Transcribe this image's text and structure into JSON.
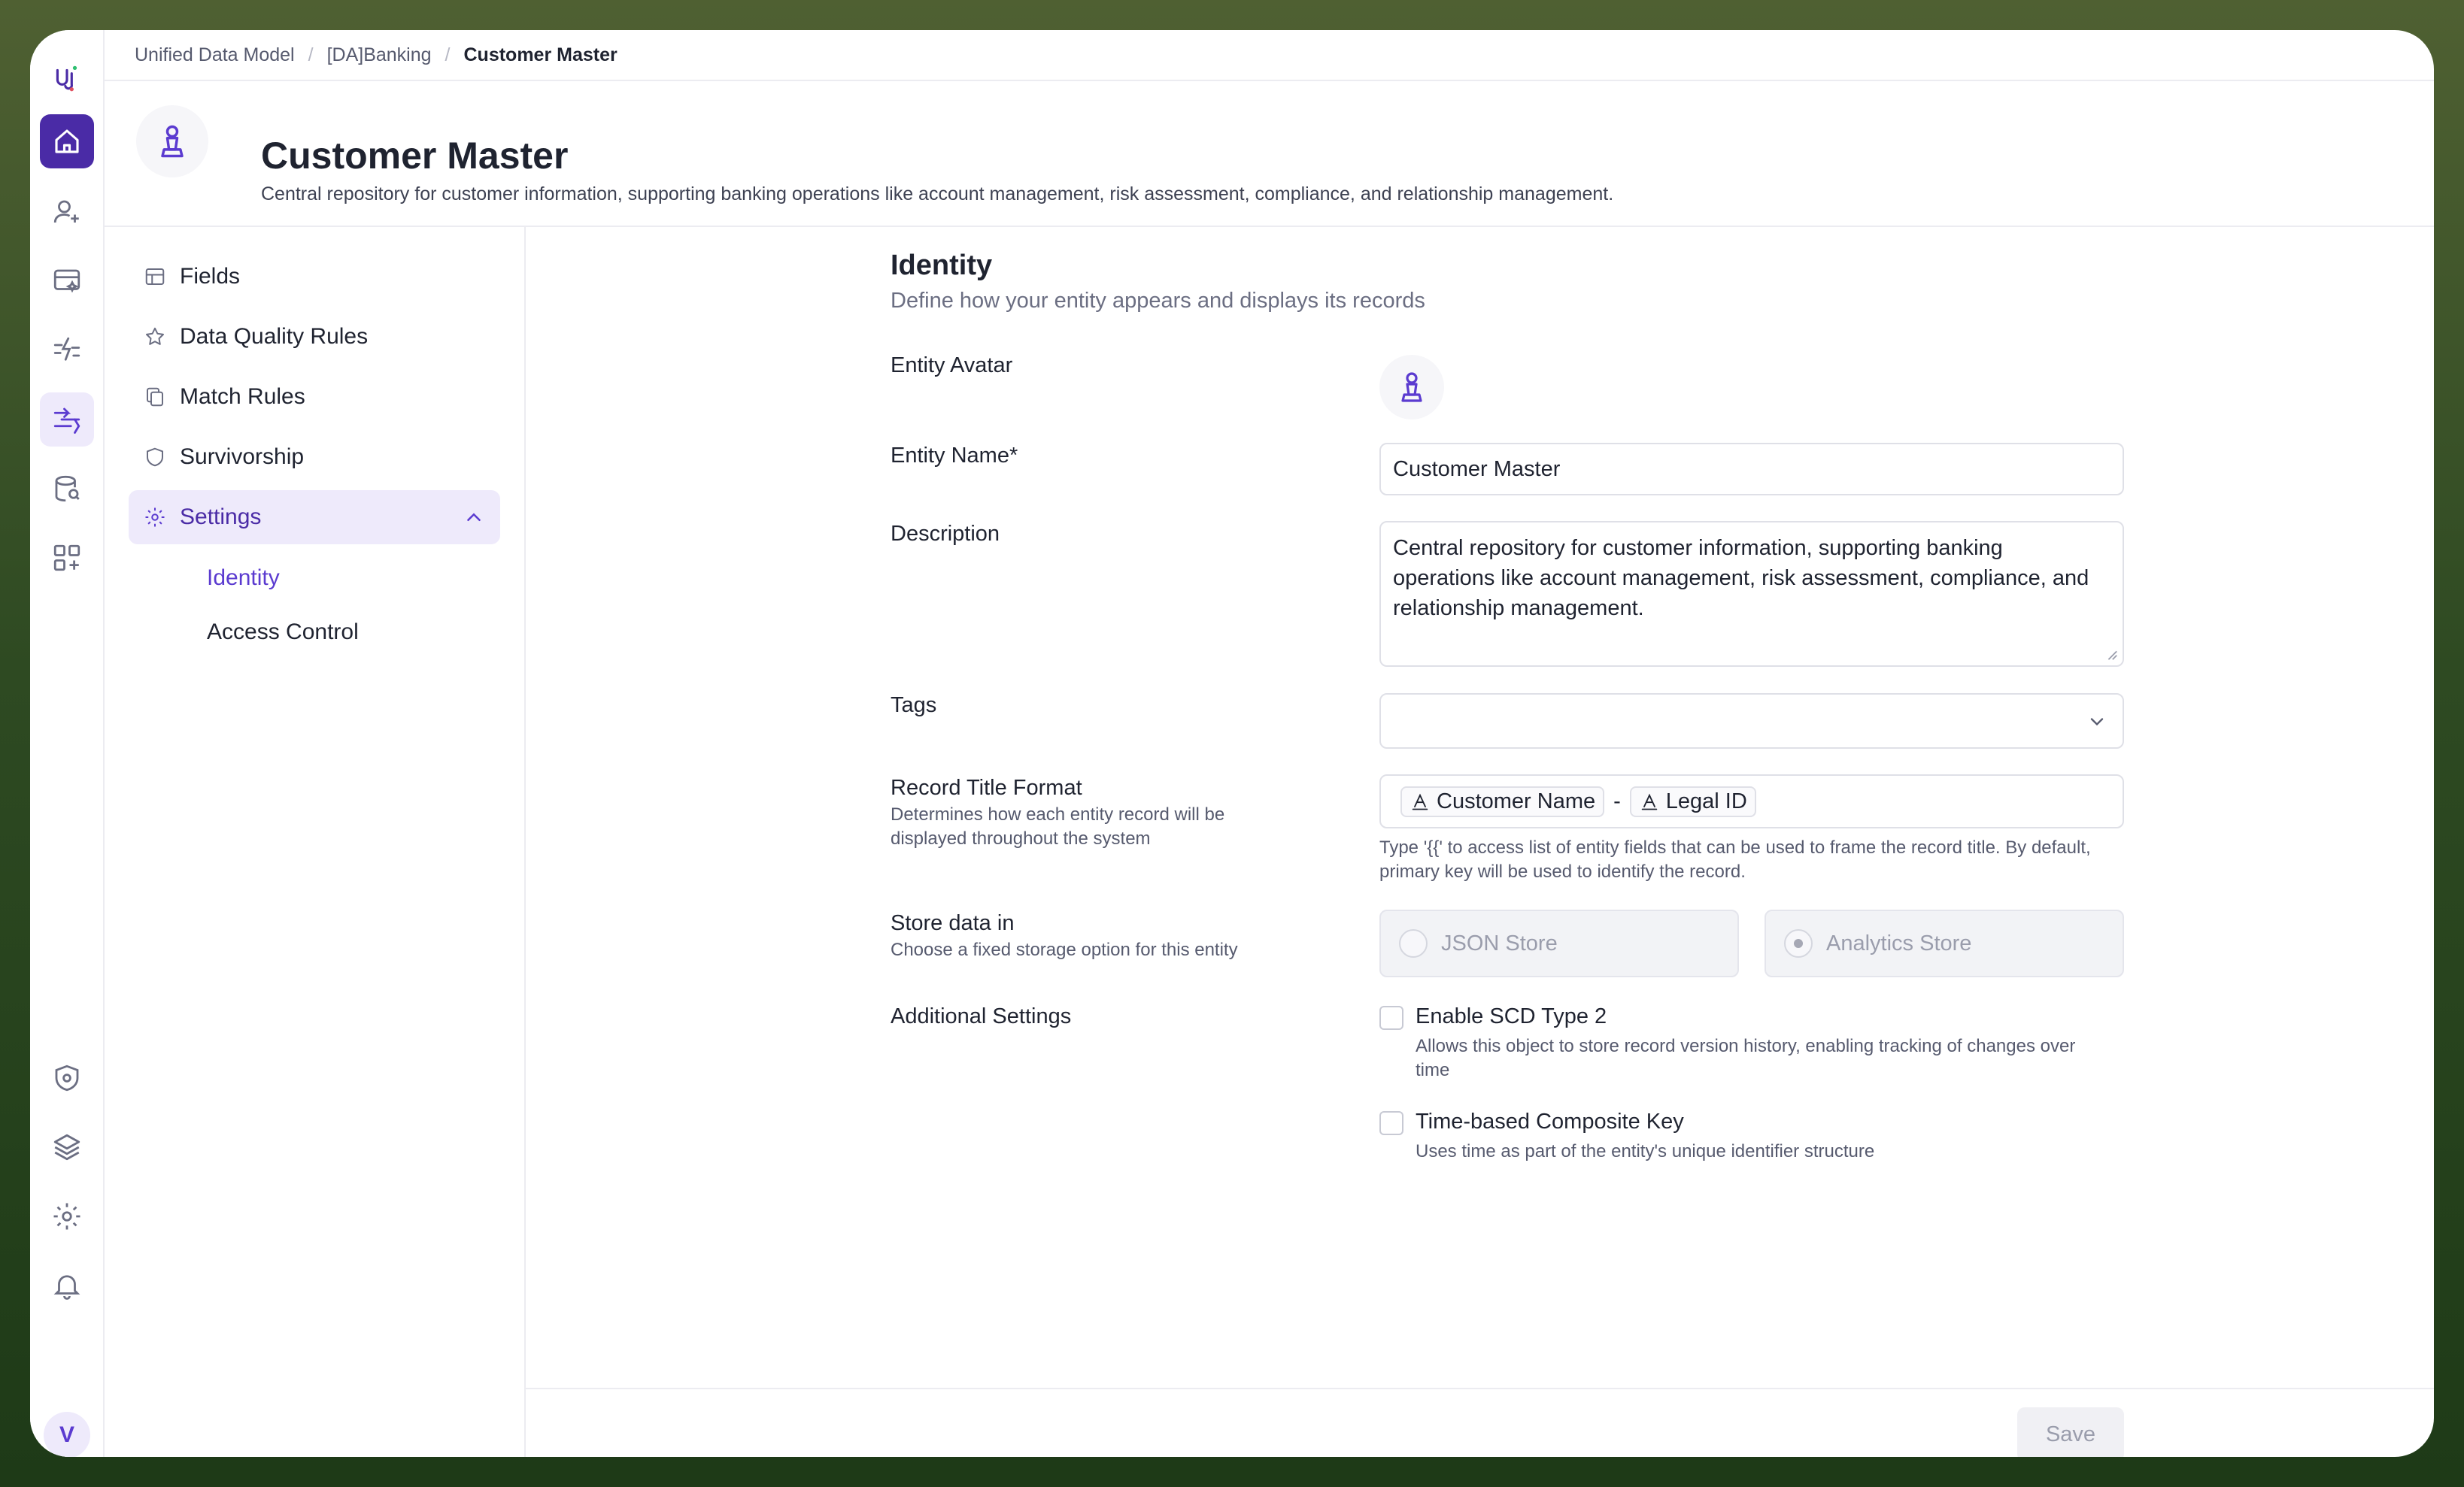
{
  "breadcrumb": {
    "items": [
      "Unified Data Model",
      "[DA]Banking",
      "Customer Master"
    ],
    "separator": "/"
  },
  "header": {
    "title": "Customer Master",
    "description": "Central repository for customer information, supporting banking operations like account management, risk assessment, compliance, and relationship management."
  },
  "user": {
    "initial": "V"
  },
  "sidenav": {
    "items": [
      {
        "label": "Fields",
        "icon": "table-icon"
      },
      {
        "label": "Data Quality Rules",
        "icon": "star-icon"
      },
      {
        "label": "Match Rules",
        "icon": "copy-icon"
      },
      {
        "label": "Survivorship",
        "icon": "shield-icon"
      },
      {
        "label": "Settings",
        "icon": "gear-icon",
        "expanded": true
      }
    ],
    "sub_items": [
      {
        "label": "Identity",
        "active": true
      },
      {
        "label": "Access Control",
        "active": false
      }
    ]
  },
  "identity": {
    "title": "Identity",
    "description": "Define how your entity appears and displays its records",
    "avatar_label": "Entity Avatar",
    "name_label": "Entity Name*",
    "name_value": "Customer Master",
    "description_label": "Description",
    "description_value": "Central repository for customer information, supporting banking operations like account management, risk assessment, compliance, and relationship management.",
    "tags_label": "Tags",
    "record_title_label": "Record Title Format",
    "record_title_sublabel": "Determines how each entity record will be displayed throughout the system",
    "record_title_chips": [
      "Customer Name",
      "Legal ID"
    ],
    "record_title_separator": "-",
    "record_title_hint": "Type '{{' to access list of entity fields that can be used to frame the record title. By default, primary key will be used to identify the record.",
    "store_label": "Store data in",
    "store_sublabel": "Choose a fixed storage option for this entity",
    "store_options": [
      {
        "label": "JSON Store",
        "selected": false
      },
      {
        "label": "Analytics Store",
        "selected": true
      }
    ],
    "additional_label": "Additional Settings",
    "scd_label": "Enable SCD Type 2",
    "scd_desc": "Allows this object to store record version history, enabling tracking of changes over time",
    "scd_checked": false,
    "composite_label": "Time-based Composite Key",
    "composite_desc": "Uses time as part of the entity's unique identifier structure",
    "composite_checked": false
  },
  "footer": {
    "save_label": "Save"
  },
  "colors": {
    "accent": "#5b3bd0",
    "accent_dark": "#4a2ba6",
    "accent_soft": "#eeeafb"
  }
}
